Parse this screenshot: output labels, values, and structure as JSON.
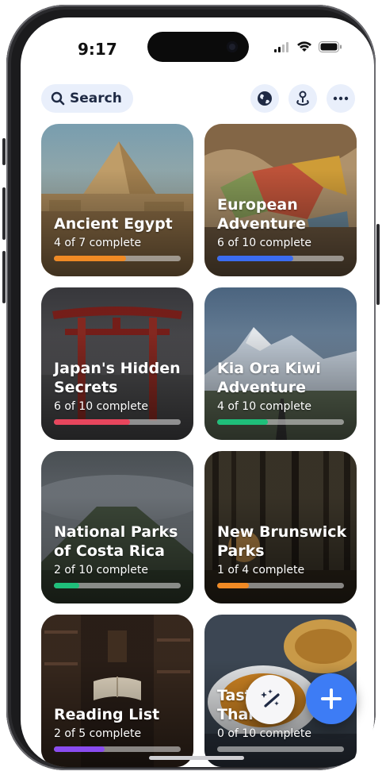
{
  "status": {
    "time": "9:17"
  },
  "search": {
    "label": "Search"
  },
  "toolbar": {
    "globe_icon": "globe-icon",
    "pin_icon": "map-pin-icon",
    "more_icon": "more-icon"
  },
  "cards": [
    {
      "title": "Ancient Egypt",
      "progress": "4 of 7 complete",
      "fraction": 0.571,
      "color": "#f08a24"
    },
    {
      "title": "European Adventure",
      "progress": "6 of 10 complete",
      "fraction": 0.6,
      "color": "#3b6cf0"
    },
    {
      "title": "Japan's Hidden Secrets",
      "progress": "6 of 10 complete",
      "fraction": 0.6,
      "color": "#e8465d"
    },
    {
      "title": "Kia Ora Kiwi Adventure",
      "progress": "4 of 10 complete",
      "fraction": 0.4,
      "color": "#1fbf7a"
    },
    {
      "title": "National Parks of Costa Rica",
      "progress": "2 of 10 complete",
      "fraction": 0.2,
      "color": "#1fbf7a"
    },
    {
      "title": "New Brunswick Parks",
      "progress": "1 of 4 complete",
      "fraction": 0.25,
      "color": "#f08a24"
    },
    {
      "title": "Reading List",
      "progress": "2 of 5 complete",
      "fraction": 0.4,
      "color": "#8a4cf0"
    },
    {
      "title": "Tast Thai",
      "progress": "0 of 10 complete",
      "fraction": 0.0,
      "color": "#3b6cf0"
    }
  ],
  "fab": {
    "magic_icon": "magic-wand-icon",
    "add_icon": "plus-icon"
  }
}
